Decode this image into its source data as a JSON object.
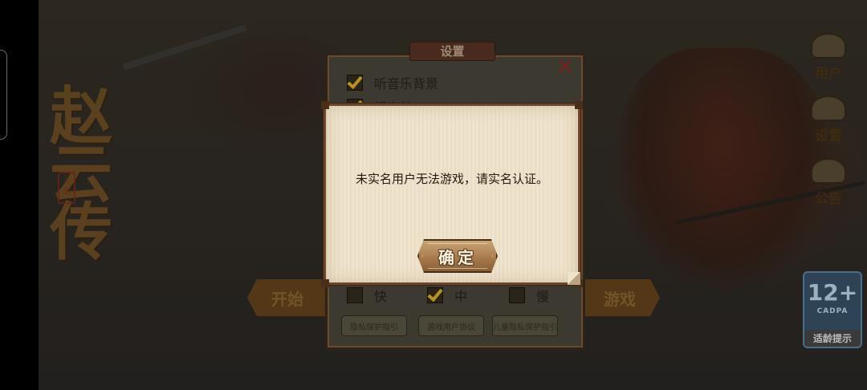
{
  "game": {
    "title_calligraphy": "赵云传",
    "seal_text": "三国",
    "side_menu": [
      {
        "label": "用户",
        "icon": "user-icon"
      },
      {
        "label": "设置",
        "icon": "gear-icon"
      },
      {
        "label": "公告",
        "icon": "notice-icon"
      }
    ],
    "age_rating": {
      "number": "12+",
      "sub": "CADPA",
      "tip": "适龄提示"
    },
    "start_left": "开始",
    "start_right": "游戏"
  },
  "settings": {
    "title": "设置",
    "close_icon": "close-icon",
    "options": [
      {
        "label": "听音乐背景",
        "checked": true
      },
      {
        "label": "播音效",
        "checked": true
      }
    ],
    "speed": [
      {
        "label": "快",
        "checked": false
      },
      {
        "label": "中",
        "checked": true
      },
      {
        "label": "慢",
        "checked": false
      }
    ],
    "links": [
      "隐私保护指引",
      "游戏用户协议",
      "儿童隐私保护指引"
    ]
  },
  "dialog": {
    "message": "未实名用户无法游戏，请实名认证。",
    "confirm_label": "确定"
  },
  "colors": {
    "dialog_bg": "#efe3cc",
    "dialog_border": "#6e4528",
    "button": "#a5784a",
    "checkmark": "#b8921a"
  }
}
